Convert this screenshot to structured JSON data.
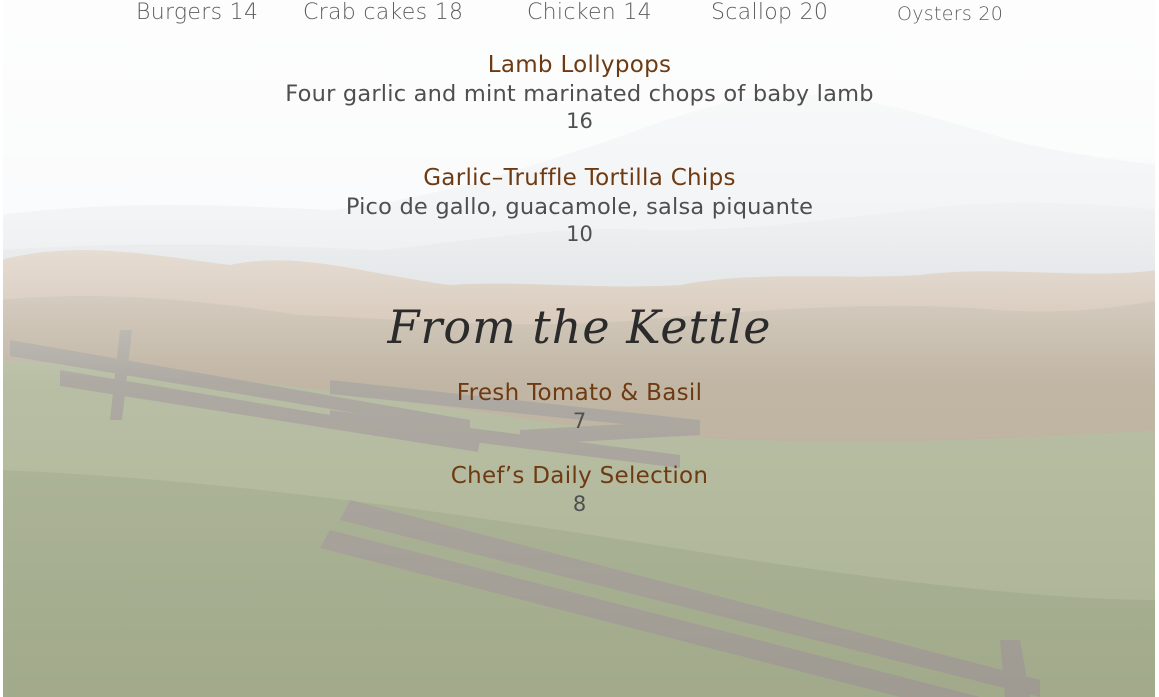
{
  "sides": [
    {
      "name": "Burgers",
      "price": "14"
    },
    {
      "name": "Crab cakes",
      "price": "18"
    },
    {
      "name": "Chicken",
      "price": "14"
    },
    {
      "name": "Scallop",
      "price": "20"
    },
    {
      "name": "Oysters",
      "price": "20"
    }
  ],
  "appetizers": [
    {
      "name": "Lamb Lollypops",
      "description": "Four garlic and mint marinated chops of baby lamb",
      "price": "16"
    },
    {
      "name": "Garlic–Truffle Tortilla Chips",
      "description": "Pico de gallo, guacamole, salsa piquante",
      "price": "10"
    }
  ],
  "kettle": {
    "heading": "From the Kettle",
    "items": [
      {
        "name": "Fresh Tomato & Basil",
        "price": "7"
      },
      {
        "name": "Chef’s Daily Selection",
        "price": "8"
      }
    ]
  }
}
